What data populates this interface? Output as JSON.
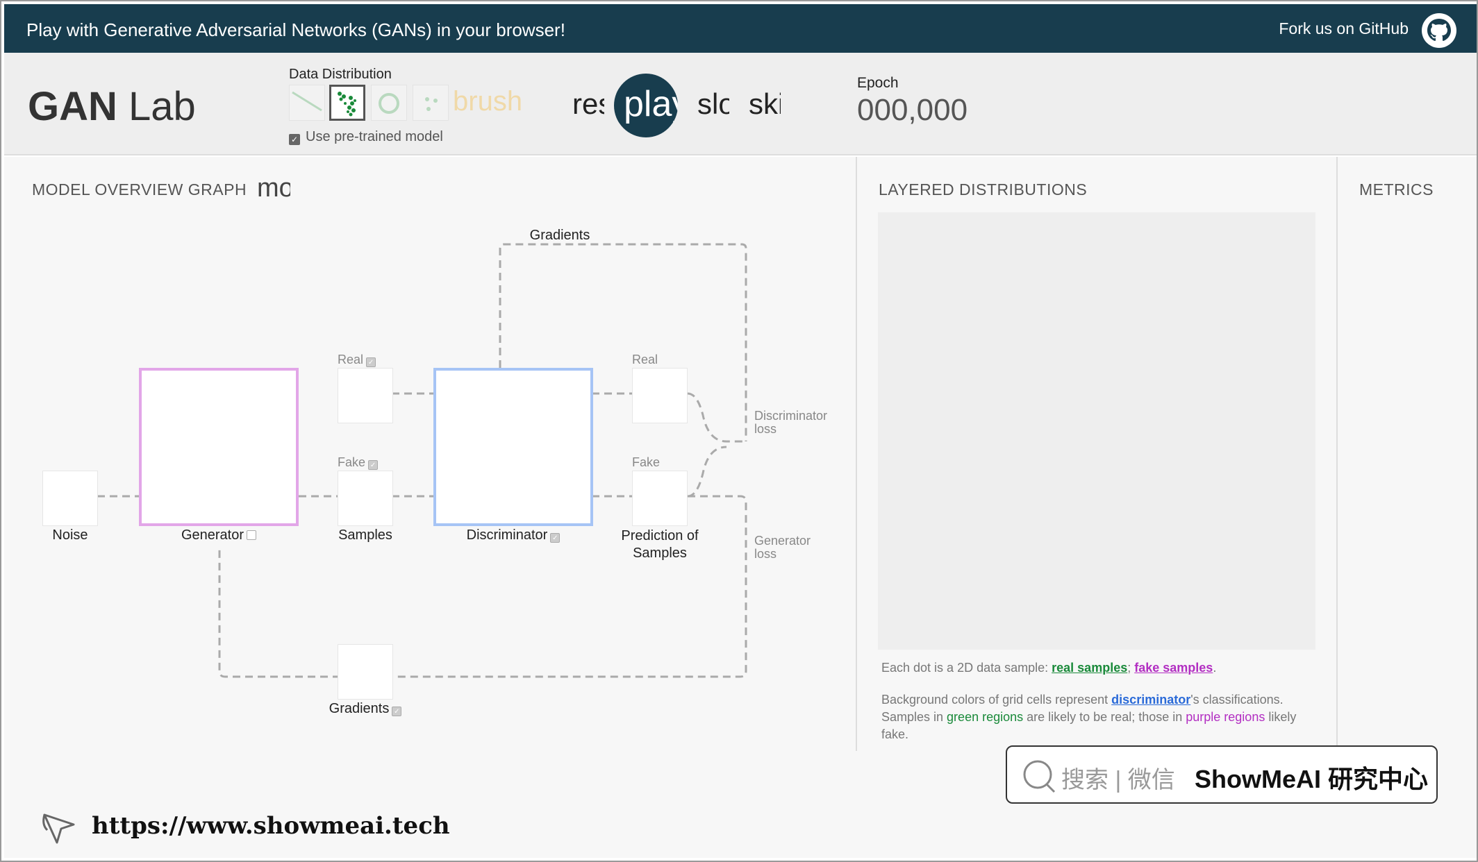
{
  "banner": {
    "title": "Play with Generative Adversarial Networks (GANs) in your browser!",
    "fork": "Fork us on GitHub"
  },
  "header": {
    "logo_bold": "GAN",
    "logo_rest": " Lab",
    "data_distribution_label": "Data Distribution",
    "brush_label": "brush",
    "pretrained_label": "Use pre-trained model",
    "controls": {
      "reset": "reset",
      "play": "play",
      "slow": "slow",
      "step": "skip"
    },
    "epoch_label": "Epoch",
    "epoch_value": "000,000"
  },
  "model": {
    "title": "MODEL OVERVIEW GRAPH",
    "title_suffix": "mode",
    "top_gradients": "Gradients",
    "noise": "Noise",
    "generator": "Generator",
    "real": "Real",
    "fake": "Fake",
    "samples": "Samples",
    "discriminator": "Discriminator",
    "pred_real": "Real",
    "pred_fake": "Fake",
    "prediction_line1": "Prediction of",
    "prediction_line2": "Samples",
    "disc_loss_1": "Discriminator",
    "disc_loss_2": "loss",
    "gen_loss_1": "Generator",
    "gen_loss_2": "loss",
    "bottom_gradients": "Gradients"
  },
  "layered": {
    "title": "LAYERED DISTRIBUTIONS",
    "legend1_prefix": "Each dot is a 2D data sample: ",
    "real_samples": "real samples",
    "sep": ";",
    "fake_samples": "fake samples",
    "period": ".",
    "legend2_a": "Background colors of grid cells represent ",
    "discriminator": "discriminator",
    "legend2_b": "'s classifications. Samples in ",
    "green_regions": "green regions",
    "legend2_c": " are likely to be real; those in ",
    "purple_regions": "purple regions",
    "legend2_d": " likely fake."
  },
  "metrics": {
    "title": "METRICS"
  },
  "watermark": {
    "search_text": "搜索 | 微信",
    "brand": "ShowMeAI 研究中心",
    "url": "https://www.showmeai.tech"
  },
  "colors": {
    "banner": "#183d4e",
    "generator": "#e2a6e8",
    "discriminator": "#a6c4f5",
    "real": "#1a8a3a",
    "fake": "#b22ec2"
  }
}
